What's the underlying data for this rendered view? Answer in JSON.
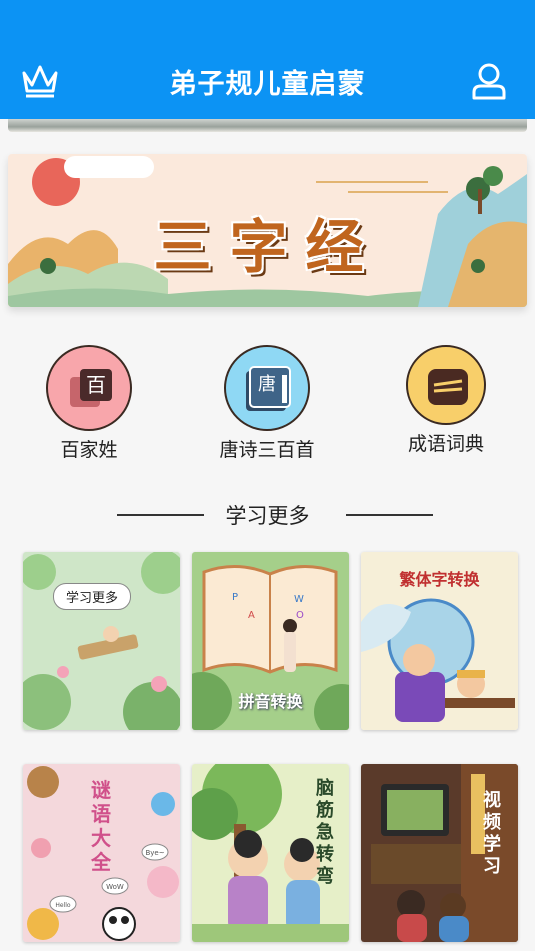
{
  "header": {
    "title": "弟子规儿童启蒙",
    "left_icon": "crown-icon",
    "right_icon": "user-icon",
    "background": "#0c93f4"
  },
  "banner": {
    "title": "三字经"
  },
  "entries": [
    {
      "label": "百家姓",
      "glyph": "百",
      "color": "#f8a6ab"
    },
    {
      "label": "唐诗三百首",
      "glyph": "唐",
      "color": "#8fd8f4"
    },
    {
      "label": "成语词典",
      "glyph": "",
      "color": "#f8cf6a"
    }
  ],
  "section": {
    "title": "学习更多"
  },
  "cards": [
    {
      "caption": "学习更多"
    },
    {
      "caption": "拼音转换",
      "book_letters": [
        "P",
        "A",
        "W",
        "O"
      ]
    },
    {
      "caption": "繁体字转换"
    },
    {
      "caption": "谜语大全",
      "bubbles": [
        "Bye~",
        "WoW",
        "Hello"
      ]
    },
    {
      "caption": "脑筋急转弯"
    },
    {
      "caption": "视频学习"
    }
  ]
}
